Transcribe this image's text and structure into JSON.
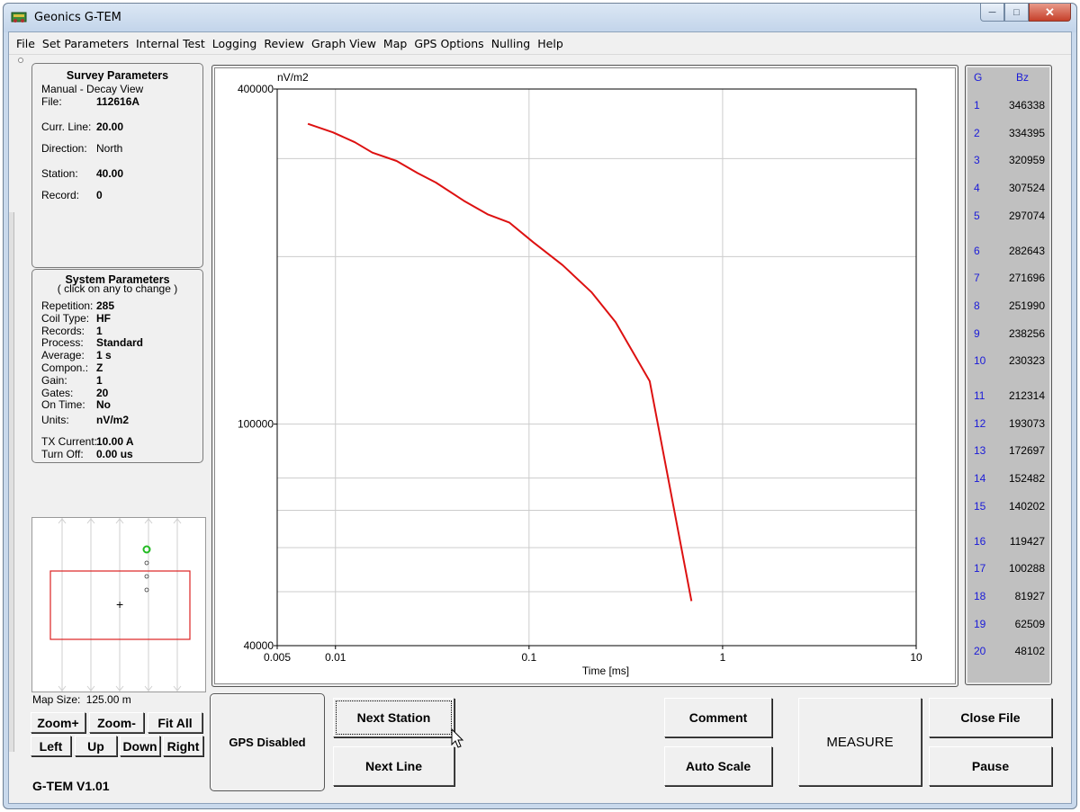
{
  "window": {
    "title": "Geonics G-TEM",
    "controls": [
      "─",
      "□",
      "✕"
    ]
  },
  "menu": [
    "File",
    "Set Parameters",
    "Internal Test",
    "Logging",
    "Review",
    "Graph View",
    "Map",
    "GPS Options",
    "Nulling",
    "Help"
  ],
  "survey": {
    "title": "Survey Parameters",
    "subtitle": "Manual - Decay View",
    "file_label": "File:",
    "file_value": "112616A",
    "line_label": "Curr. Line:",
    "line_value": "20.00",
    "direction_label": "Direction:",
    "direction_value": "North",
    "station_label": "Station:",
    "station_value": "40.00",
    "record_label": "Record:",
    "record_value": "0"
  },
  "system": {
    "title": "System Parameters",
    "subtitle": "( click on any to change )",
    "rows": [
      {
        "label": "Repetition:",
        "value": "285"
      },
      {
        "label": "Coil Type:",
        "value": "HF"
      },
      {
        "label": "Records:",
        "value": "1"
      },
      {
        "label": "Process:",
        "value": "Standard"
      },
      {
        "label": "Average:",
        "value": "1 s"
      },
      {
        "label": "Compon.:",
        "value": "Z"
      },
      {
        "label": "Gain:",
        "value": "1"
      },
      {
        "label": "Gates:",
        "value": "20"
      },
      {
        "label": "On Time:",
        "value": "No"
      }
    ],
    "units_label": "Units:",
    "units_value": "nV/m2",
    "tx_label": "TX Current:",
    "tx_value": "10.00 A",
    "turnoff_label": "Turn Off:",
    "turnoff_value": "0.00 us"
  },
  "map": {
    "size_label": "Map Size:",
    "size_value": "125.00 m",
    "buttons": {
      "zoom_in": "Zoom+",
      "zoom_out": "Zoom-",
      "fit_all": "Fit All",
      "left": "Left",
      "up": "Up",
      "down": "Down",
      "right": "Right"
    }
  },
  "version": "G-TEM V1.01",
  "gps_status": "GPS Disabled",
  "buttons": {
    "next_station": "Next Station",
    "next_line": "Next Line",
    "comment": "Comment",
    "auto_scale": "Auto Scale",
    "measure": "MEASURE",
    "close_file": "Close File",
    "pause": "Pause"
  },
  "gates": {
    "header_gate": "G",
    "header_value": "Bz",
    "rows": [
      {
        "g": "1",
        "bz": "346338"
      },
      {
        "g": "2",
        "bz": "334395"
      },
      {
        "g": "3",
        "bz": "320959"
      },
      {
        "g": "4",
        "bz": "307524"
      },
      {
        "g": "5",
        "bz": "297074"
      },
      {
        "g": "6",
        "bz": "282643"
      },
      {
        "g": "7",
        "bz": "271696"
      },
      {
        "g": "8",
        "bz": "251990"
      },
      {
        "g": "9",
        "bz": "238256"
      },
      {
        "g": "10",
        "bz": "230323"
      },
      {
        "g": "11",
        "bz": "212314"
      },
      {
        "g": "12",
        "bz": "193073"
      },
      {
        "g": "13",
        "bz": "172697"
      },
      {
        "g": "14",
        "bz": "152482"
      },
      {
        "g": "15",
        "bz": "140202"
      },
      {
        "g": "16",
        "bz": "119427"
      },
      {
        "g": "17",
        "bz": "100288"
      },
      {
        "g": "18",
        "bz": "81927"
      },
      {
        "g": "19",
        "bz": "62509"
      },
      {
        "g": "20",
        "bz": "48102"
      }
    ]
  },
  "colors": {
    "curve": "#dd1111",
    "gate_number": "#1a1ad8",
    "map_rect": "#dd2222",
    "station_marker": "#22bb22"
  },
  "chart_data": {
    "type": "line",
    "xscale": "log",
    "yscale": "log",
    "xlabel": "Time [ms]",
    "ylabel": "nV/m2",
    "xlim": [
      0.005,
      10
    ],
    "ylim": [
      40000,
      400000
    ],
    "x_ticks": [
      "0.005",
      "0.01",
      "0.1",
      "1",
      "10"
    ],
    "y_ticks": [
      "40000",
      "100000",
      "400000"
    ],
    "grid": true,
    "series": [
      {
        "x": [
          0.0072,
          0.0097,
          0.0126,
          0.0155,
          0.0207,
          0.0265,
          0.033,
          0.046,
          0.061,
          0.079,
          0.105,
          0.149,
          0.21,
          0.28,
          0.42,
          0.69
        ],
        "values": [
          346338,
          334395,
          320959,
          307524,
          297074,
          282643,
          271696,
          251990,
          238256,
          230323,
          212314,
          193073,
          172697,
          152482,
          119427,
          48102
        ]
      }
    ]
  }
}
